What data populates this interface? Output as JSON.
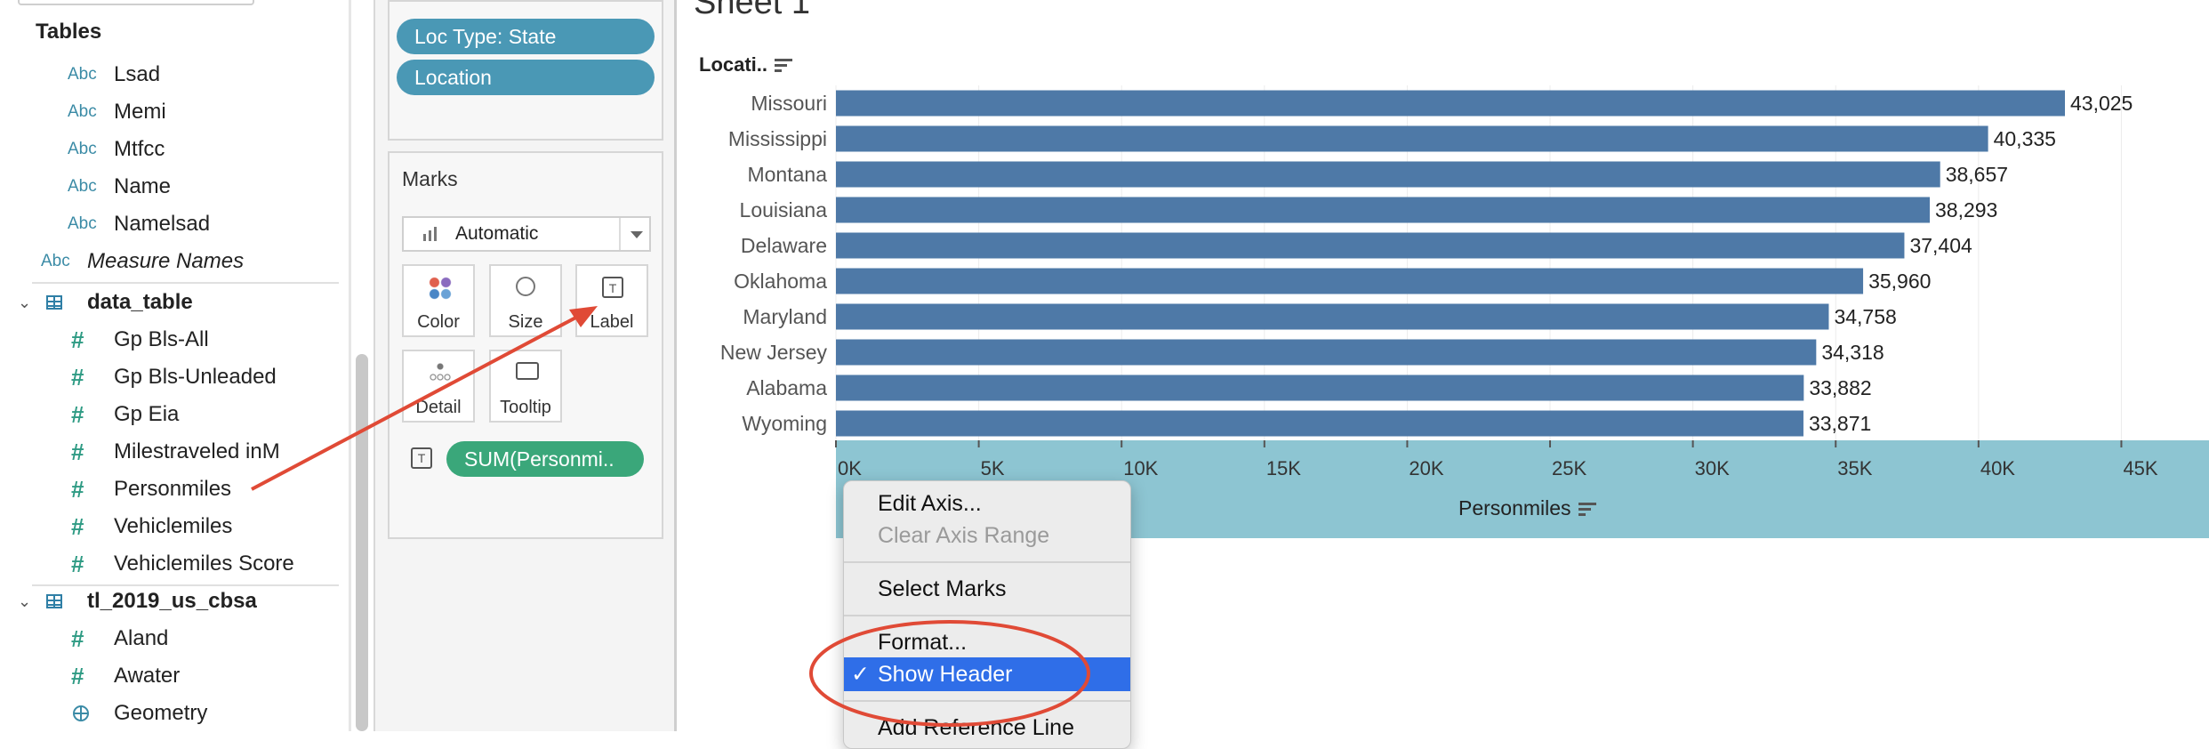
{
  "data_pane": {
    "section_title": "Tables",
    "fields_top": [
      {
        "icon": "Abc",
        "label": "Lsad"
      },
      {
        "icon": "Abc",
        "label": "Memi"
      },
      {
        "icon": "Abc",
        "label": "Mtfcc"
      },
      {
        "icon": "Abc",
        "label": "Name"
      },
      {
        "icon": "Abc",
        "label": "Namelsad"
      }
    ],
    "measure_names": {
      "icon": "Abc",
      "label": "Measure Names"
    },
    "table1": {
      "name": "data_table",
      "chevron": "⌄"
    },
    "fields_data_table": [
      {
        "icon": "#",
        "label": "Gp Bls-All"
      },
      {
        "icon": "#",
        "label": "Gp Bls-Unleaded"
      },
      {
        "icon": "#",
        "label": "Gp Eia"
      },
      {
        "icon": "#",
        "label": "Milestraveled inM"
      },
      {
        "icon": "#",
        "label": "Personmiles"
      },
      {
        "icon": "#",
        "label": "Vehiclemiles"
      },
      {
        "icon": "#",
        "label": "Vehiclemiles Score"
      }
    ],
    "table2": {
      "name": "tl_2019_us_cbsa",
      "chevron": "⌄"
    },
    "fields_cbsa": [
      {
        "icon": "#",
        "label": "Aland"
      },
      {
        "icon": "#",
        "label": "Awater"
      },
      {
        "icon": "globe",
        "label": "Geometry"
      }
    ]
  },
  "shelves": {
    "detail_pills": [
      "Loc Type: State",
      "Location"
    ],
    "marks_title": "Marks",
    "mark_type": "Automatic",
    "mark_buttons": {
      "color": "Color",
      "size": "Size",
      "label": "Label",
      "detail": "Detail",
      "tooltip": "Tooltip"
    },
    "label_pill": "SUM(Personmi..",
    "t_icon": "T"
  },
  "view": {
    "sheet_title": "Sheet 1",
    "row_header": "Locati..",
    "axis_title": "Personmiles"
  },
  "chart_data": {
    "type": "bar",
    "orientation": "horizontal",
    "categories": [
      "Missouri",
      "Mississippi",
      "Montana",
      "Louisiana",
      "Delaware",
      "Oklahoma",
      "Maryland",
      "New Jersey",
      "Alabama",
      "Wyoming"
    ],
    "values": [
      43025,
      40335,
      38657,
      38293,
      37404,
      35960,
      34758,
      34318,
      33882,
      33871
    ],
    "value_labels": [
      "43,025",
      "40,335",
      "38,657",
      "38,293",
      "37,404",
      "35,960",
      "34,758",
      "34,318",
      "33,882",
      "33,871"
    ],
    "ticks": [
      "0K",
      "5K",
      "10K",
      "15K",
      "20K",
      "25K",
      "30K",
      "35K",
      "40K",
      "45K"
    ],
    "xlim": [
      0,
      47500
    ],
    "xlabel": "Personmiles",
    "ylabel": "Locati..",
    "bar_color": "#4e79a7",
    "axis_band_color": "#8dc5d2"
  },
  "context_menu": {
    "items": [
      {
        "label": "Edit Axis...",
        "state": "normal"
      },
      {
        "label": "Clear Axis Range",
        "state": "disabled"
      },
      {
        "label": "Select Marks",
        "state": "normal"
      },
      {
        "label": "Format...",
        "state": "normal"
      },
      {
        "label": "Show Header",
        "state": "selected",
        "check": "✓"
      },
      {
        "label": "Add Reference Line",
        "state": "normal"
      }
    ]
  },
  "colors": {
    "pill_blue": "#4a98b5",
    "pill_green": "#3aa77a",
    "menu_highlight": "#2f6ee8",
    "annotation_red": "#e04a36"
  }
}
